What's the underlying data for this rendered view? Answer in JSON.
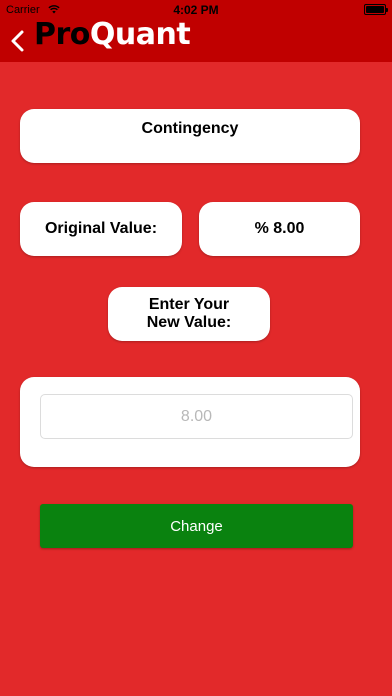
{
  "status_bar": {
    "carrier": "Carrier",
    "time": "4:02 PM"
  },
  "header": {
    "logo_part1": "Pro",
    "logo_part2": "Quant",
    "back_icon": "chevron-left-icon"
  },
  "main": {
    "title": "Contingency",
    "original_label": "Original Value:",
    "original_value": "% 8.00",
    "prompt_line1": "Enter Your",
    "prompt_line2": "New Value:",
    "input_value": "",
    "input_placeholder": "8.00",
    "change_label": "Change"
  },
  "colors": {
    "background": "#e2292a",
    "header": "#c00000",
    "button": "#0a820f"
  }
}
